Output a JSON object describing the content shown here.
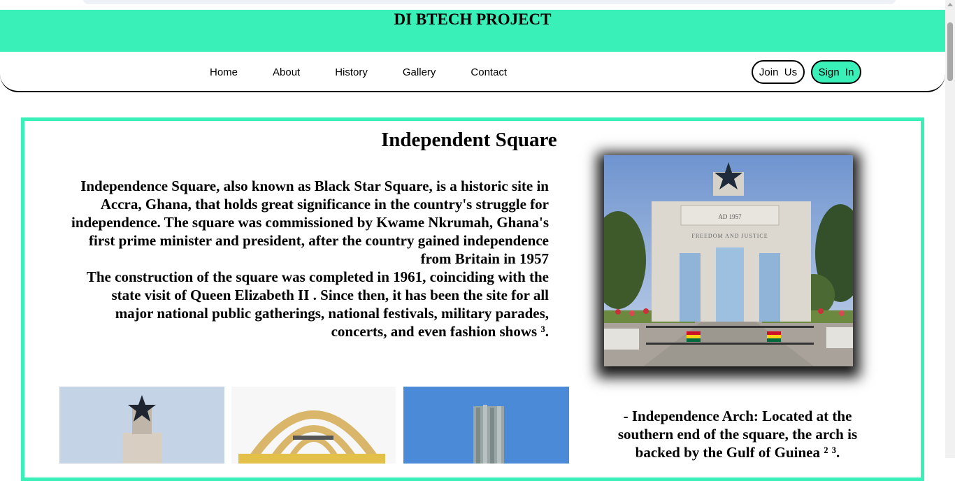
{
  "header": {
    "title": "DI BTECH PROJECT"
  },
  "nav": {
    "links": [
      {
        "label": "Home"
      },
      {
        "label": "About"
      },
      {
        "label": "History"
      },
      {
        "label": "Gallery"
      },
      {
        "label": "Contact"
      }
    ],
    "join_label": "Join  Us",
    "signin_label": "Sign  In"
  },
  "section": {
    "title": "Independent Square",
    "paragraph_1": "Independence Square, also known as Black Star Square, is a historic site in Accra, Ghana, that holds great significance in the country's struggle for independence. The square was commissioned by Kwame Nkrumah, Ghana's first prime minister and president, after the country gained independence from Britain in 1957",
    "paragraph_2": "The construction of the square was completed in 1961, coinciding with the state visit of Queen Elizabeth II . Since then, it has been the site for all major national public gatherings, national festivals, military parades, concerts, and even fashion shows ³.",
    "caption": "- Independence Arch: Located at the southern end of the square, the arch is backed by the Gulf of Guinea ² ³."
  },
  "images": {
    "arch_inscription_top": "AD 1957",
    "arch_inscription_bottom": "FREEDOM AND JUSTICE"
  },
  "colors": {
    "accent": "#38f0b8",
    "text": "#000000",
    "background": "#ffffff"
  }
}
